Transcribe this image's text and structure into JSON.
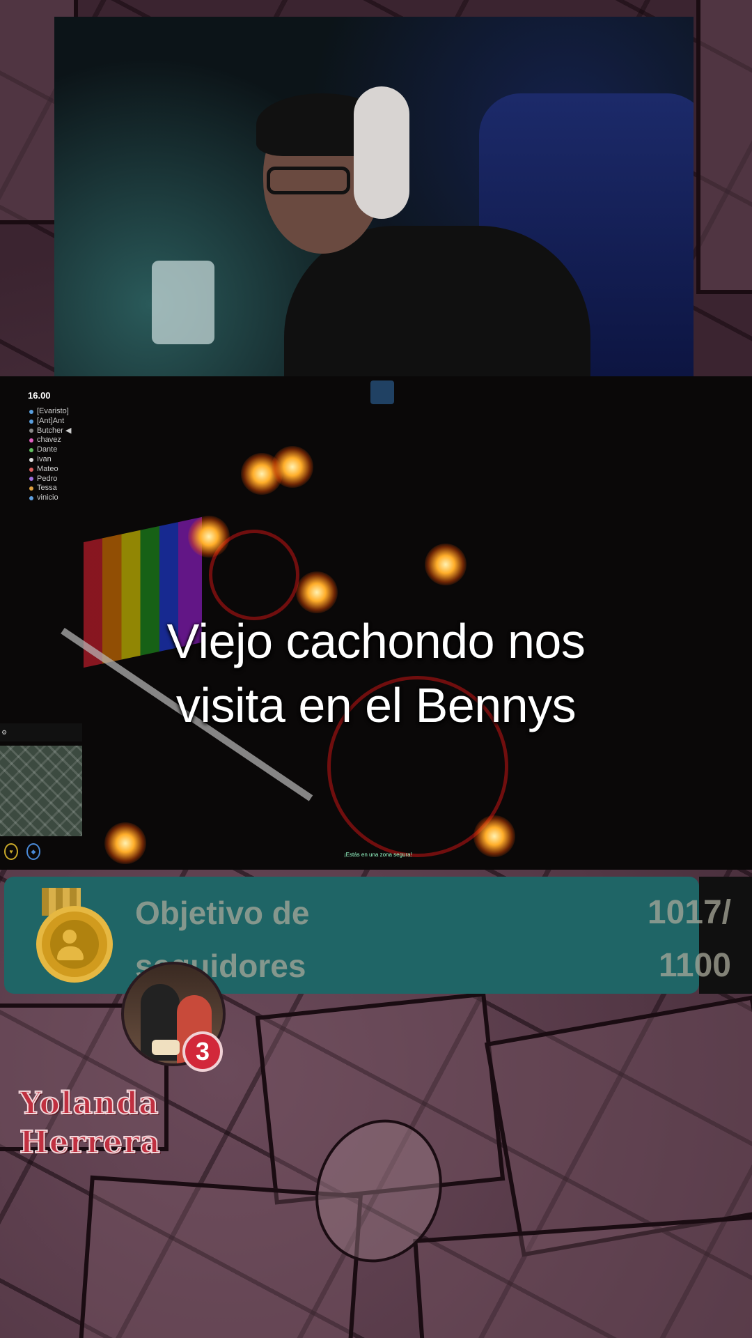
{
  "game_hud": {
    "time": "16.00",
    "players": [
      {
        "name": "[Evaristo]",
        "color": "#5aa0e0"
      },
      {
        "name": "[Ant]Ant",
        "color": "#5aa0e0"
      },
      {
        "name": "Butcher ◀",
        "color": "#888888"
      },
      {
        "name": "chavez",
        "color": "#e060c0"
      },
      {
        "name": "Dante",
        "color": "#60c060"
      },
      {
        "name": "Ivan",
        "color": "#dddddd"
      },
      {
        "name": "Mateo",
        "color": "#e06060"
      },
      {
        "name": "Pedro",
        "color": "#a070e0"
      },
      {
        "name": "Tessa",
        "color": "#e0a040"
      },
      {
        "name": "vinicio",
        "color": "#60a0e0"
      }
    ],
    "safe_zone_text": "¡Estás en una zona segura!"
  },
  "caption": {
    "line1": "Viejo cachondo nos",
    "line2": "visita en el Bennys"
  },
  "follower_goal": {
    "title": "Objetivo de seguidores",
    "count_line1": "1017/",
    "count_line2": "1100",
    "current": 1017,
    "target": 1100,
    "medal_icon": "followers-medal-icon"
  },
  "supporter": {
    "rank": "3",
    "name_line1": "Yolanda",
    "name_line2": "Herrera"
  },
  "colors": {
    "goal_bg": "#1f6566",
    "rank_badge": "#d2283a",
    "username": "#c03040"
  }
}
